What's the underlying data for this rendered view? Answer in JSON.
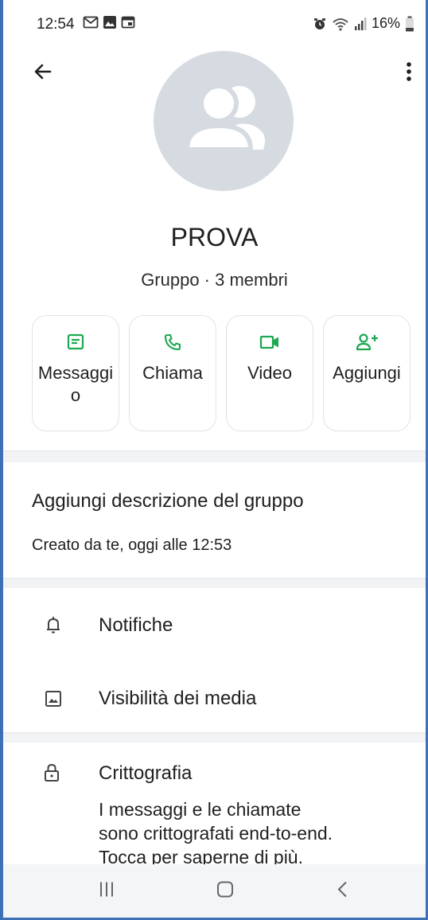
{
  "status_bar": {
    "time": "12:54",
    "battery": "16%",
    "left_icons": [
      "gmail-icon",
      "gallery-icon",
      "calendar-icon"
    ],
    "right_icons": [
      "alarm-icon",
      "wifi-icon",
      "signal-icon",
      "battery-icon"
    ]
  },
  "header": {
    "back_icon": "arrow-left-icon",
    "menu_icon": "more-vert-icon"
  },
  "group": {
    "avatar_icon": "group-icon",
    "name": "PROVA",
    "subtitle": "Gruppo · 3 membri"
  },
  "actions": [
    {
      "label": "Messaggio",
      "icon": "message-icon"
    },
    {
      "label": "Chiama",
      "icon": "phone-icon"
    },
    {
      "label": "Video",
      "icon": "video-icon"
    },
    {
      "label": "Aggiungi",
      "icon": "add-person-icon"
    }
  ],
  "description": {
    "add_label": "Aggiungi descrizione del gruppo",
    "created": "Creato da te, oggi alle 12:53"
  },
  "settings": [
    {
      "label": "Notifiche",
      "icon": "bell-icon"
    },
    {
      "label": "Visibilità dei media",
      "icon": "image-icon"
    }
  ],
  "encryption": {
    "icon": "lock-icon",
    "title": "Crittografia",
    "text": "I messaggi e le chiamate\nsono crittografati end-to-end.\nTocca per saperne di più."
  },
  "navbar": {
    "icons": [
      "recents-icon",
      "home-icon",
      "back-nav-icon"
    ]
  },
  "colors": {
    "accent": "#1da851",
    "avatar_bg": "#d5dbe0",
    "divider": "#f2f3f4",
    "frame": "#3f6fb6"
  }
}
